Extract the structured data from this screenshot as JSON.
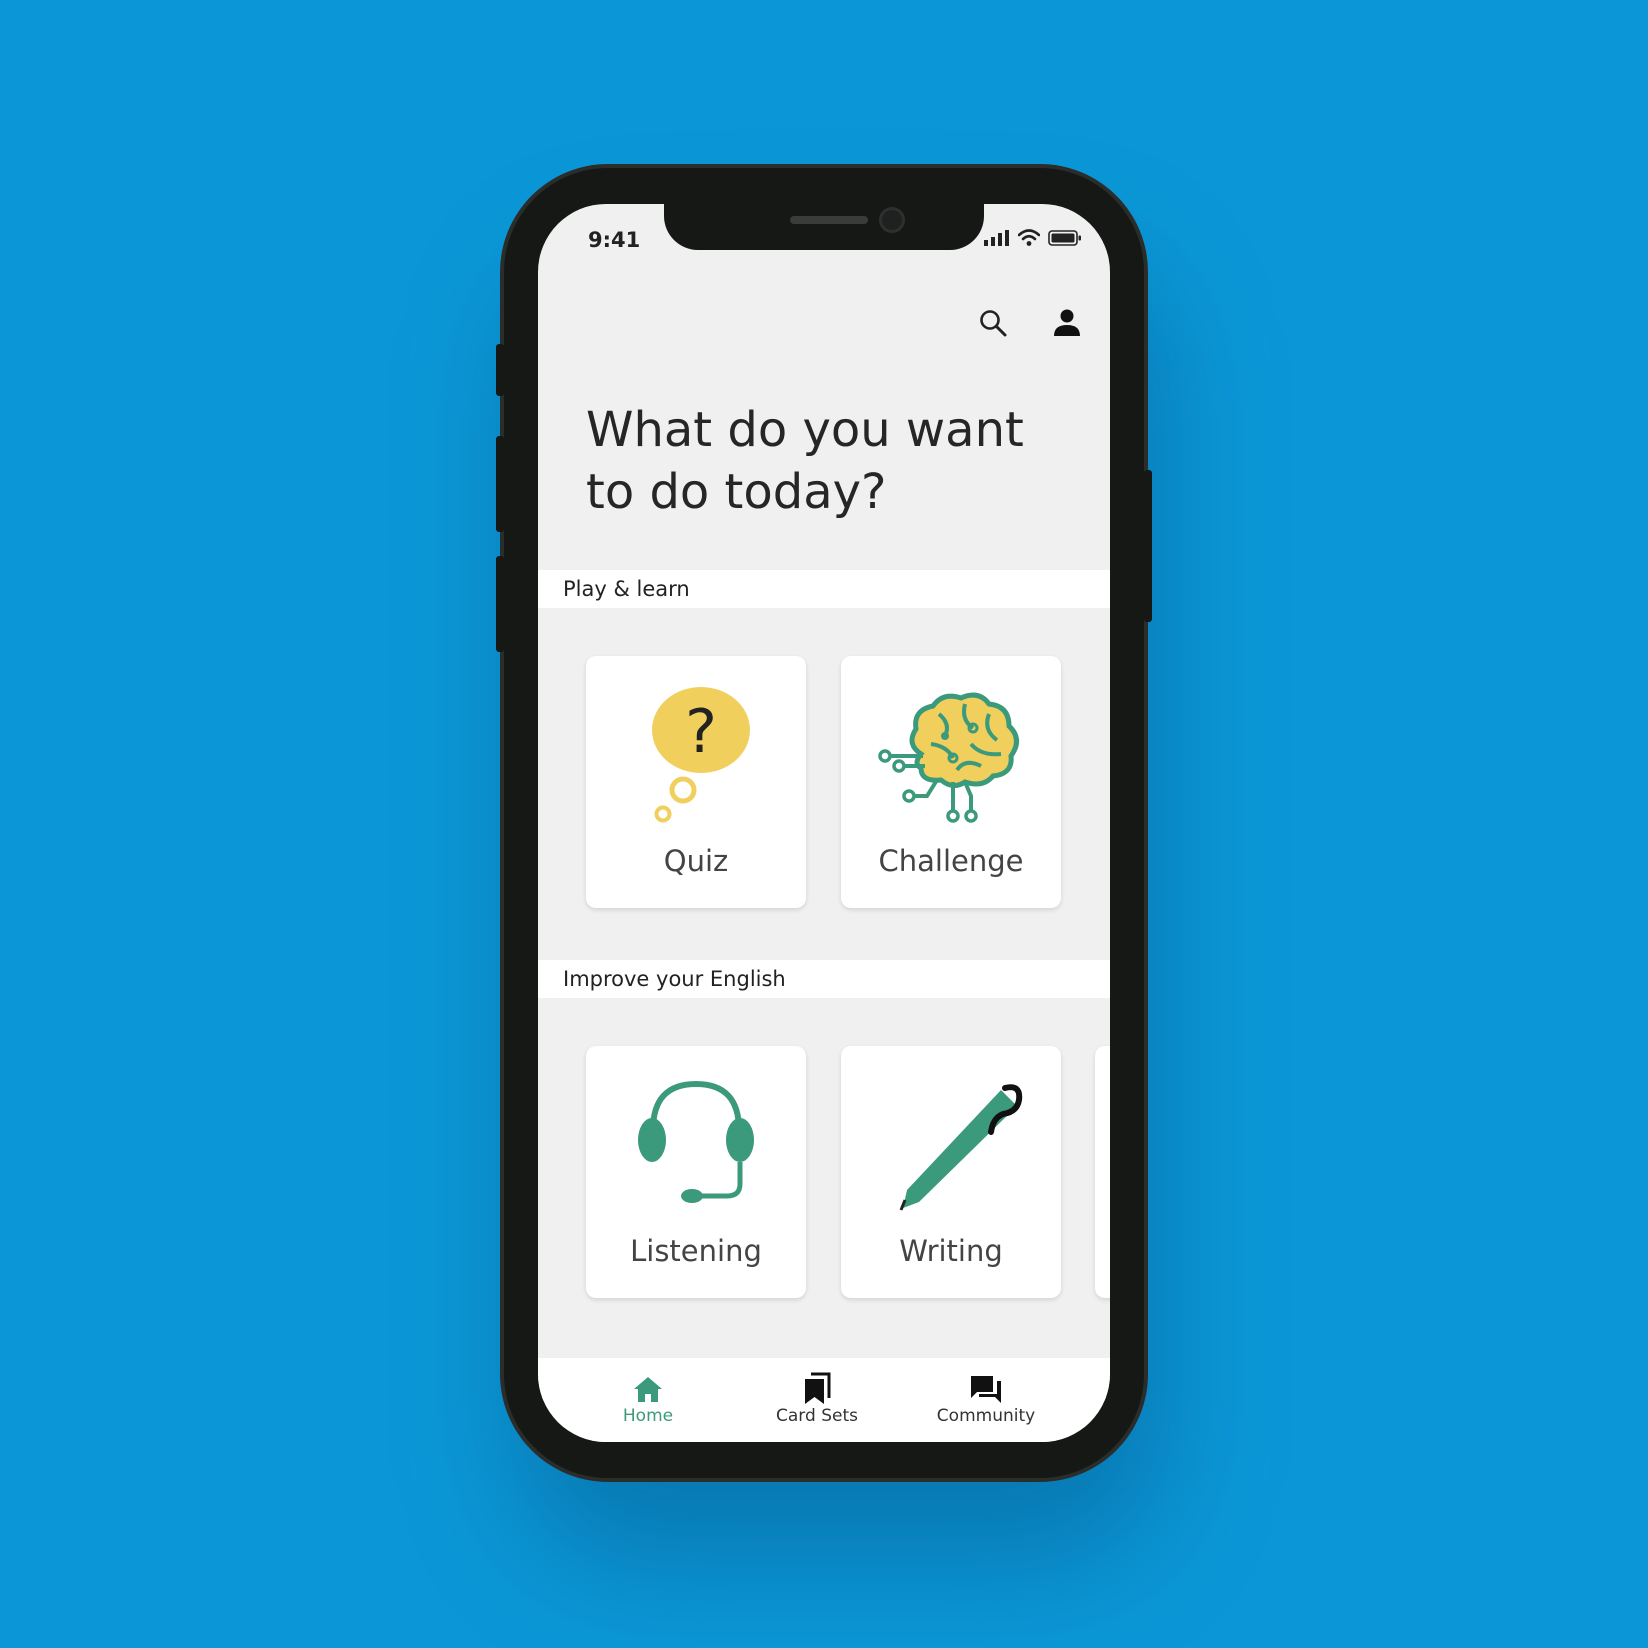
{
  "status_bar": {
    "time": "9:41"
  },
  "header": {
    "headline": "What do you want to do today?"
  },
  "sections": [
    {
      "title": "Play & learn",
      "cards": [
        {
          "label": "Quiz",
          "icon": "thought-bubble-question-icon"
        },
        {
          "label": "Challenge",
          "icon": "brain-circuit-icon"
        }
      ]
    },
    {
      "title": "Improve your English",
      "cards": [
        {
          "label": "Listening",
          "icon": "headset-icon"
        },
        {
          "label": "Writing",
          "icon": "pen-icon"
        }
      ]
    }
  ],
  "bottom_nav": [
    {
      "label": "Home",
      "icon": "home-icon",
      "active": true
    },
    {
      "label": "Card Sets",
      "icon": "bookmark-icon",
      "active": false
    },
    {
      "label": "Community",
      "icon": "chat-icon",
      "active": false
    }
  ],
  "colors": {
    "background": "#0b97d7",
    "accent": "#3c9a7c",
    "yellow": "#f1cf5d",
    "text": "#262626"
  }
}
